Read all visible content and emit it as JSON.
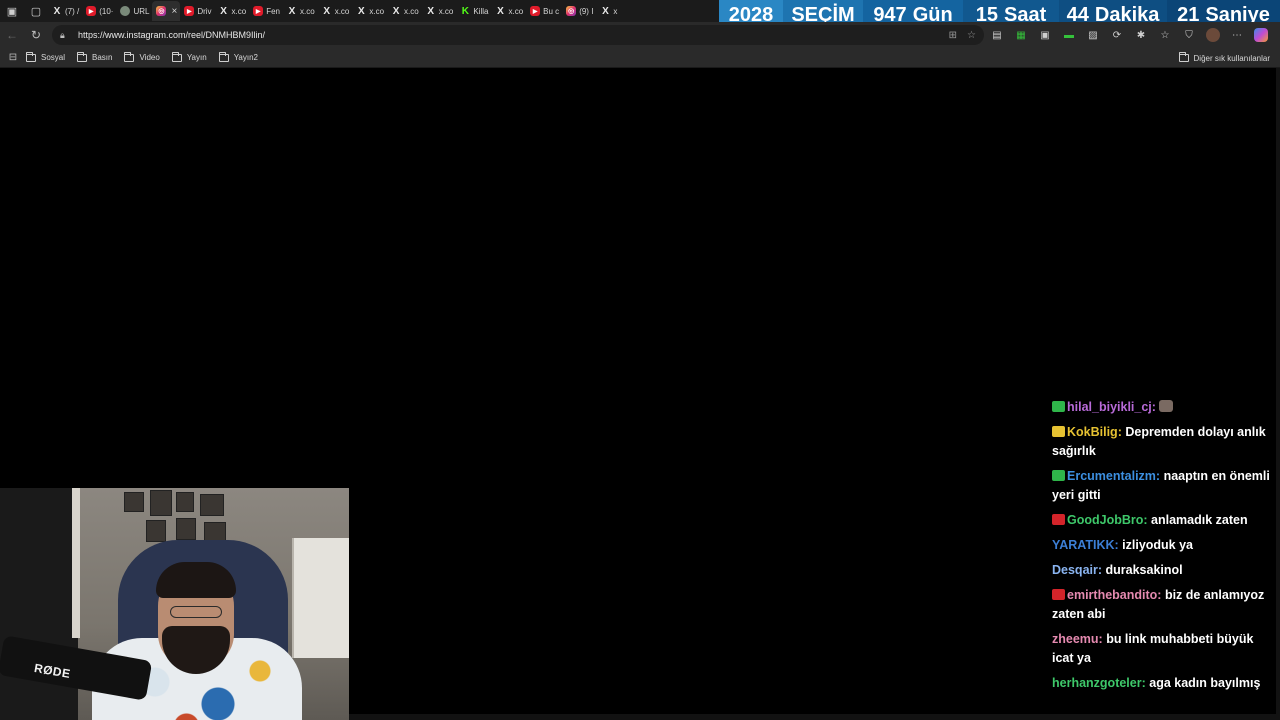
{
  "tabs": [
    {
      "icon": "x-icon",
      "label": "(7) /",
      "fav": "x"
    },
    {
      "icon": "youtube-icon",
      "label": "(10·",
      "fav": "yt"
    },
    {
      "icon": "site-icon",
      "label": "URL",
      "fav": "gen"
    },
    {
      "icon": "instagram-icon",
      "label": "",
      "fav": "ig",
      "active": true
    },
    {
      "icon": "youtube-icon",
      "label": "Driv",
      "fav": "yt"
    },
    {
      "icon": "x-icon",
      "label": "x.co",
      "fav": "x"
    },
    {
      "icon": "youtube-icon",
      "label": "Fen",
      "fav": "yt"
    },
    {
      "icon": "x-icon",
      "label": "x.co",
      "fav": "x"
    },
    {
      "icon": "x-icon",
      "label": "x.co",
      "fav": "x"
    },
    {
      "icon": "x-icon",
      "label": "x.co",
      "fav": "x"
    },
    {
      "icon": "x-icon",
      "label": "x.co",
      "fav": "x"
    },
    {
      "icon": "x-icon",
      "label": "x.co",
      "fav": "x"
    },
    {
      "icon": "kick-icon",
      "label": "Killa",
      "fav": "kick"
    },
    {
      "icon": "x-icon",
      "label": "x.co",
      "fav": "x"
    },
    {
      "icon": "youtube-icon",
      "label": "Bu c",
      "fav": "yt"
    },
    {
      "icon": "instagram-icon",
      "label": "(9) I",
      "fav": "ig"
    },
    {
      "icon": "x-icon",
      "label": "x",
      "fav": "x"
    }
  ],
  "countdown": {
    "year": "2028",
    "label": "SEÇİM",
    "days_value": "947",
    "days_unit": "Gün",
    "hours_value": "15",
    "hours_unit": "Saat",
    "minutes_value": "44",
    "minutes_unit": "Dakika",
    "seconds_value": "21",
    "seconds_unit": "Saniye"
  },
  "address_bar": {
    "url": "https://www.instagram.com/reel/DNMHBM9Ilin/"
  },
  "bookmarks": {
    "items": [
      "Sosyal",
      "Basın",
      "Video",
      "Yayın",
      "Yayın2"
    ],
    "other": "Diğer sık kullanılanlar"
  },
  "chat": [
    {
      "user": "hilal_biyikli_cj:",
      "text": "",
      "color": "#b86ad8",
      "badge": "green",
      "emote": true
    },
    {
      "user": "KokBilig:",
      "text": "Depremden dolayı anlık sağırlık",
      "color": "#e6c232",
      "badge": "yellow"
    },
    {
      "user": "Ercumentalizm:",
      "text": "naaptın en önemli yeri gitti",
      "color": "#3c8fe0",
      "badge": "green"
    },
    {
      "user": "GoodJobBro:",
      "text": "anlamadık zaten",
      "color": "#3ec86a",
      "badge": "red"
    },
    {
      "user": "YARATIKK:",
      "text": "izliyoduk ya",
      "color": "#3c7fd6",
      "badge": ""
    },
    {
      "user": "Desqair:",
      "text": "duraksakinol",
      "color": "#8ab4f0",
      "badge": ""
    },
    {
      "user": "emirthebandito:",
      "text": "biz de anlamıyoz zaten abi",
      "color": "#e58ab0",
      "badge": "red"
    },
    {
      "user": "zheemu:",
      "text": "bu link muhabbeti büyük icat ya",
      "color": "#e58ab0",
      "badge": ""
    },
    {
      "user": "herhanzgoteler:",
      "text": "aga kadın bayılmış",
      "color": "#3ec86a",
      "badge": ""
    }
  ],
  "webcam": {
    "mic_brand": "RØDE"
  },
  "colors": {
    "countdown_bg": "#1464a0",
    "chrome_bg": "#2a2a2a"
  }
}
